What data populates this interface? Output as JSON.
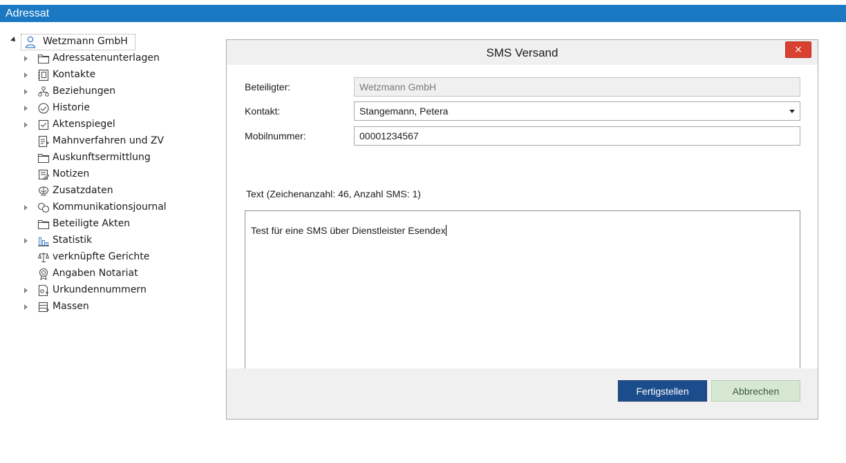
{
  "app": {
    "title": "Adressat"
  },
  "tree": {
    "root": {
      "label": "Wetzmann GmbH",
      "icon": "person-icon"
    },
    "items": [
      {
        "label": "Adressatenunterlagen",
        "icon": "folder-icon",
        "expandable": true
      },
      {
        "label": "Kontakte",
        "icon": "address-book-icon",
        "expandable": true
      },
      {
        "label": "Beziehungen",
        "icon": "hierarchy-icon",
        "expandable": true
      },
      {
        "label": "Historie",
        "icon": "clock-icon",
        "expandable": true
      },
      {
        "label": "Aktenspiegel",
        "icon": "checklist-icon",
        "expandable": true
      },
      {
        "label": "Mahnverfahren und ZV",
        "icon": "document-list-icon",
        "expandable": false
      },
      {
        "label": "Auskunftsermittlung",
        "icon": "folder-icon",
        "expandable": false
      },
      {
        "label": "Notizen",
        "icon": "note-icon",
        "expandable": false
      },
      {
        "label": "Zusatzdaten",
        "icon": "data-icon",
        "expandable": false
      },
      {
        "label": "Kommunikationsjournal",
        "icon": "chat-icon",
        "expandable": true
      },
      {
        "label": "Beteiligte Akten",
        "icon": "folder-icon",
        "expandable": false
      },
      {
        "label": "Statistik",
        "icon": "bar-chart-icon",
        "expandable": true
      },
      {
        "label": "verknüpfte Gerichte",
        "icon": "scales-icon",
        "expandable": false
      },
      {
        "label": "Angaben Notariat",
        "icon": "seal-icon",
        "expandable": false
      },
      {
        "label": "Urkundennummern",
        "icon": "certificate-icon",
        "expandable": true
      },
      {
        "label": "Massen",
        "icon": "list-icon",
        "expandable": true
      }
    ]
  },
  "dialog": {
    "title": "SMS Versand",
    "close_label": "×",
    "fields": {
      "beteiligter_label": "Beteiligter:",
      "beteiligter_value": "Wetzmann GmbH",
      "kontakt_label": "Kontakt:",
      "kontakt_value": "Stangemann, Petera",
      "mobil_label": "Mobilnummer:",
      "mobil_value": "00001234567"
    },
    "text_caption": "Text (Zeichenanzahl: 46, Anzahl SMS: 1)",
    "message": "Test für eine SMS über Dienstleister Esendex",
    "finish_label": "Fertigstellen",
    "cancel_label": "Abbrechen"
  },
  "colors": {
    "header_blue": "#1b79c4",
    "primary_button": "#1b4c8c",
    "secondary_button": "#d6e7d2",
    "close_red": "#d9402f"
  }
}
